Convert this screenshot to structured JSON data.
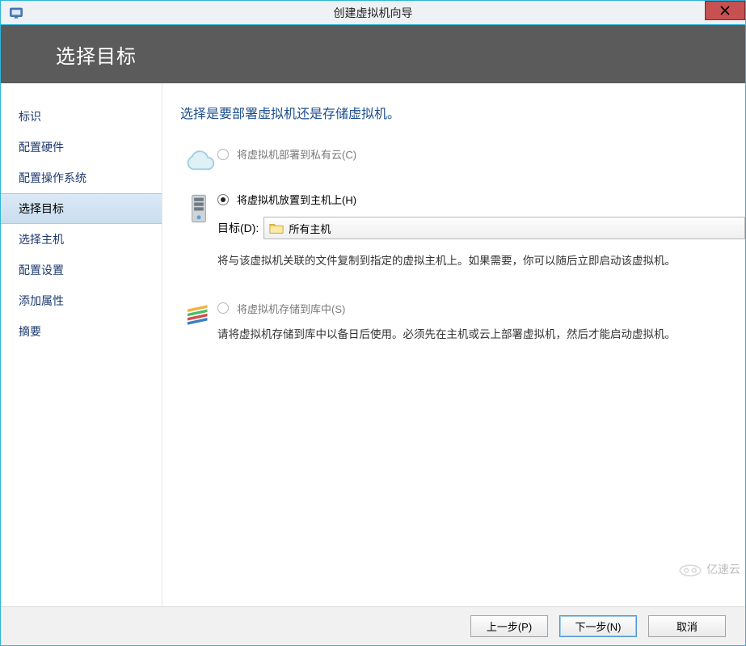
{
  "window": {
    "title": "创建虚拟机向导"
  },
  "header": {
    "title": "选择目标"
  },
  "sidebar": {
    "items": [
      {
        "label": "标识"
      },
      {
        "label": "配置硬件"
      },
      {
        "label": "配置操作系统"
      },
      {
        "label": "选择目标"
      },
      {
        "label": "选择主机"
      },
      {
        "label": "配置设置"
      },
      {
        "label": "添加属性"
      },
      {
        "label": "摘要"
      }
    ],
    "selected_index": 3
  },
  "content": {
    "heading": "选择是要部署虚拟机还是存储虚拟机。",
    "options": {
      "cloud": {
        "label": "将虚拟机部署到私有云(C)",
        "enabled": false,
        "selected": false
      },
      "host": {
        "label": "将虚拟机放置到主机上(H)",
        "enabled": true,
        "selected": true,
        "target_label": "目标(D):",
        "target_value": "所有主机",
        "description": "将与该虚拟机关联的文件复制到指定的虚拟主机上。如果需要，你可以随后立即启动该虚拟机。"
      },
      "library": {
        "label": "将虚拟机存储到库中(S)",
        "enabled": false,
        "selected": false,
        "description": "请将虚拟机存储到库中以备日后使用。必须先在主机或云上部署虚拟机，然后才能启动虚拟机。"
      }
    }
  },
  "footer": {
    "previous": "上一步(P)",
    "next": "下一步(N)",
    "cancel": "取消"
  },
  "watermark": "亿速云"
}
